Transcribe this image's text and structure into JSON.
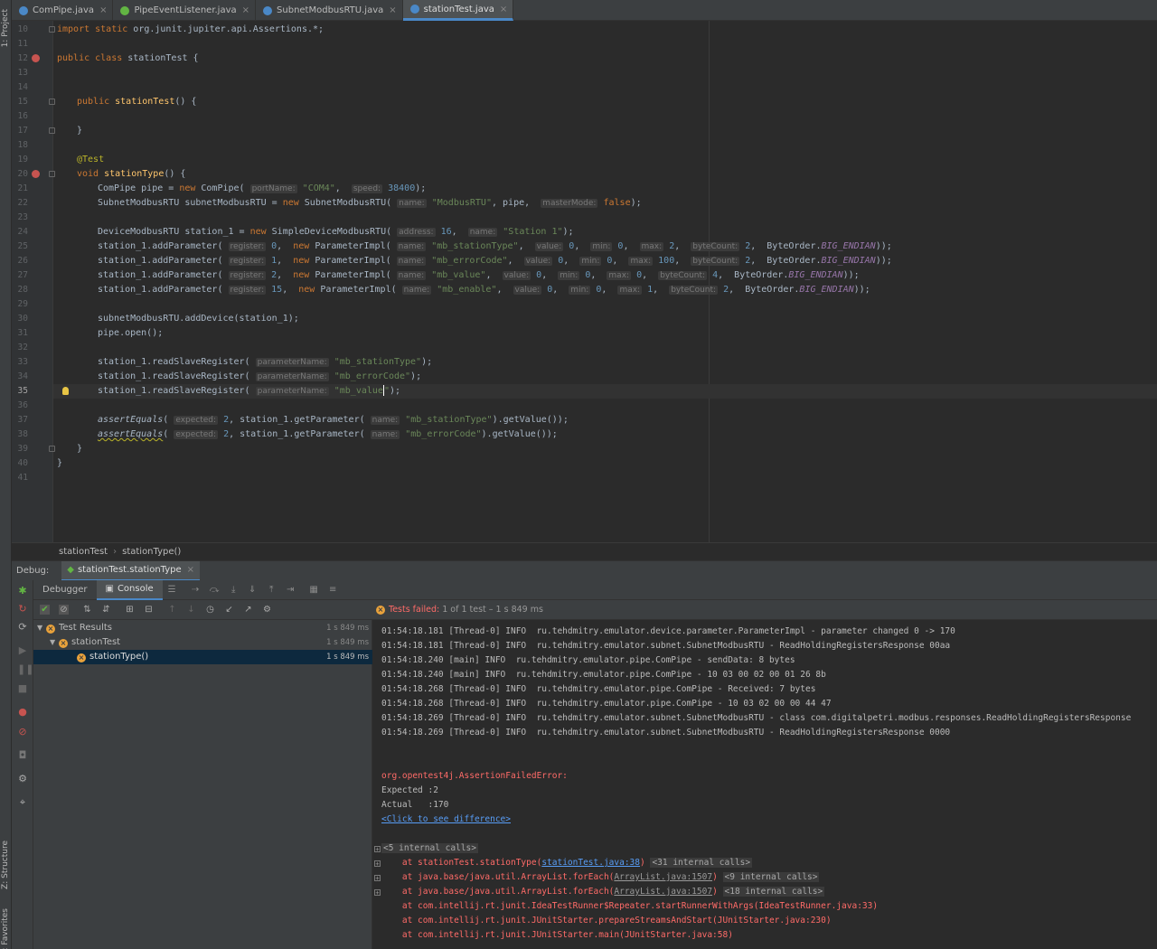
{
  "left_strip": {
    "project": "1: Project",
    "structure": "Z: Structure",
    "favorites": "2: Favorites"
  },
  "tabs": [
    {
      "label": "ComPipe.java",
      "color": "#4a88c7",
      "active": false
    },
    {
      "label": "PipeEventListener.java",
      "color": "#62b543",
      "active": false
    },
    {
      "label": "SubnetModbusRTU.java",
      "color": "#4a88c7",
      "active": false
    },
    {
      "label": "stationTest.java",
      "color": "#4a88c7",
      "active": true
    }
  ],
  "tab_close": "×",
  "line_numbers": [
    "10",
    "11",
    "12",
    "13",
    "14",
    "15",
    "16",
    "17",
    "18",
    "19",
    "20",
    "21",
    "22",
    "23",
    "24",
    "25",
    "26",
    "27",
    "28",
    "29",
    "30",
    "31",
    "32",
    "33",
    "34",
    "35",
    "36",
    "37",
    "38",
    "39",
    "40",
    "41"
  ],
  "code": {
    "l10_kw": "import static",
    "l10_rest": " org.junit.jupiter.api.Assertions.*;",
    "l12_kw": "public class",
    "l12_rest": " stationTest {",
    "l15_kw": "public",
    "l15_fn": " stationTest",
    "l15_rest": "() {",
    "l17": "}",
    "l19": "@Test",
    "l20_kw": "void",
    "l20_fn": " stationType",
    "l20_rest": "() {",
    "l21_a": "ComPipe pipe = ",
    "l21_new": "new",
    "l21_b": " ComPipe(",
    "l21_h1": "portName:",
    "l21_s1": "\"COM4\"",
    "l21_c": ",  ",
    "l21_h2": "speed:",
    "l21_n2": "38400",
    "l21_end": ");",
    "l22_a": "SubnetModbusRTU subnetModbusRTU = ",
    "l22_new": "new",
    "l22_b": " SubnetModbusRTU(",
    "l22_h1": "name:",
    "l22_s1": "\"ModbusRTU\"",
    "l22_c": ", pipe,  ",
    "l22_h2": "masterMode:",
    "l22_k2": "false",
    "l22_end": ");",
    "l24_a": "DeviceModbusRTU station_1 = ",
    "l24_new": "new",
    "l24_b": " SimpleDeviceModbusRTU(",
    "l24_h1": "address:",
    "l24_n1": "16",
    "l24_c": ",  ",
    "l24_h2": "name:",
    "l24_s2": "\"Station 1\"",
    "l24_end": ");",
    "add_a": "station_1.addParameter(",
    "h_register": "register:",
    "new_kw": "new",
    "impl": " ParameterImpl(",
    "h_name": "name:",
    "h_value": "value:",
    "h_min": "min:",
    "h_max": "max:",
    "h_bytecount": "byteCount:",
    "byteorder": "ByteOrder.",
    "big_endian": "BIG_ENDIAN",
    "close2": "));",
    "p25": {
      "reg": "0",
      "name": "\"mb_stationType\"",
      "value": "0",
      "min": "0",
      "max": "2",
      "bc": "2"
    },
    "p26": {
      "reg": "1",
      "name": "\"mb_errorCode\"",
      "value": "0",
      "min": "0",
      "max": "100",
      "bc": "2"
    },
    "p27": {
      "reg": "2",
      "name": "\"mb_value\"",
      "value": "0",
      "min": "0",
      "max": "0",
      "bc": "4"
    },
    "p28": {
      "reg": "15",
      "name": "\"mb_enable\"",
      "value": "0",
      "min": "0",
      "max": "1",
      "bc": "2"
    },
    "l30": "subnetModbusRTU.addDevice(station_1);",
    "l31": "pipe.open();",
    "read_a": "station_1.readSlaveRegister(",
    "h_paramname": "parameterName:",
    "r33": "\"mb_stationType\"",
    "r34": "\"mb_errorCode\"",
    "r35": "\"mb_value",
    "r35_tail": "\"",
    "read_end": ");",
    "assert_fn": "assertEquals",
    "h_expected": "expected:",
    "exp_val": "2",
    "get_param": ", station_1.getParameter(",
    "get_val": ").getValue());",
    "a37": "\"mb_stationType\"",
    "a38": "\"mb_errorCode\"",
    "open_paren": "(",
    "comma": ",  "
  },
  "breadcrumb": [
    "stationTest",
    "stationType()"
  ],
  "debug": {
    "label": "Debug:",
    "session": "stationTest.stationType",
    "close": "×"
  },
  "debug_tabs": [
    "Debugger",
    "Console"
  ],
  "tests_status": {
    "failed": "Tests failed:",
    "rest": "1 of 1 test – 1 s 849 ms"
  },
  "tree": [
    {
      "label": "Test Results",
      "time": "1 s 849 ms",
      "indent": 0
    },
    {
      "label": "stationTest",
      "time": "1 s 849 ms",
      "indent": 1
    },
    {
      "label": "stationType()",
      "time": "1 s 849 ms",
      "indent": 2
    }
  ],
  "console_lines": [
    "01:54:18.181 [Thread-0] INFO  ru.tehdmitry.emulator.device.parameter.ParameterImpl - parameter changed 0 -> 170",
    "01:54:18.181 [Thread-0] INFO  ru.tehdmitry.emulator.subnet.SubnetModbusRTU - ReadHoldingRegistersResponse 00aa",
    "01:54:18.240 [main] INFO  ru.tehdmitry.emulator.pipe.ComPipe - sendData: 8 bytes",
    "01:54:18.240 [main] INFO  ru.tehdmitry.emulator.pipe.ComPipe - 10 03 00 02 00 01 26 8b",
    "01:54:18.268 [Thread-0] INFO  ru.tehdmitry.emulator.pipe.ComPipe - Received: 7 bytes",
    "01:54:18.268 [Thread-0] INFO  ru.tehdmitry.emulator.pipe.ComPipe - 10 03 02 00 00 44 47",
    "01:54:18.269 [Thread-0] INFO  ru.tehdmitry.emulator.subnet.SubnetModbusRTU - class com.digitalpetri.modbus.responses.ReadHoldingRegistersResponse",
    "01:54:18.269 [Thread-0] INFO  ru.tehdmitry.emulator.subnet.SubnetModbusRTU - ReadHoldingRegistersResponse 0000"
  ],
  "error": {
    "type": "org.opentest4j.AssertionFailedError:",
    "expected": "Expected :2",
    "actual": "Actual   :170",
    "diff_link": "<Click to see difference>",
    "internal5": "<5 internal calls>",
    "st1_a": "    at stationTest.stationType(",
    "st1_link": "stationTest.java:38",
    "st1_b": ")",
    "st1_ic": "<31 internal calls>",
    "st2_a": "    at java.base/java.util.ArrayList.forEach(",
    "st2_link": "ArrayList.java:1507",
    "st2_b": ")",
    "st2_ic": "<9 internal calls>",
    "st3_a": "    at java.base/java.util.ArrayList.forEach(",
    "st3_link": "ArrayList.java:1507",
    "st3_b": ")",
    "st3_ic": "<18 internal calls>",
    "st4": "    at com.intellij.rt.junit.IdeaTestRunner$Repeater.startRunnerWithArgs(IdeaTestRunner.java:33)",
    "st5": "    at com.intellij.rt.junit.JUnitStarter.prepareStreamsAndStart(JUnitStarter.java:230)",
    "st6": "    at com.intellij.rt.junit.JUnitStarter.main(JUnitStarter.java:58)"
  },
  "colors": {
    "accent": "#4a88c7",
    "error": "#ff6b68",
    "warn": "#e9a23b",
    "selection": "#0d293e"
  }
}
